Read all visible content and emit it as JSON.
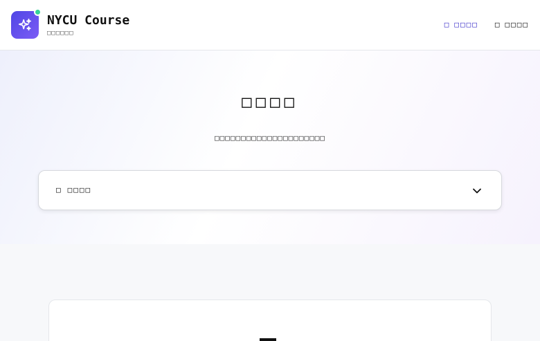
{
  "header": {
    "brand_title": "NYCU Course",
    "brand_subtitle": "□□□□□□",
    "nav": [
      {
        "icon_glyph": "□",
        "label": "□□□□",
        "active": true
      },
      {
        "icon_glyph": "□",
        "label": "□□□□",
        "active": false
      }
    ],
    "logo_icon": "sparkles-icon",
    "status_color": "#34d399"
  },
  "hero": {
    "title": "□□□□",
    "subtitle": "□□□□□□□□□□□□□□□□□□□□□",
    "select": {
      "icon_glyph": "□",
      "value": "□□□□",
      "chevron_icon": "chevron-down-icon"
    }
  },
  "colors": {
    "accent": "#4f46e5",
    "nav_active": "#3b2fc9"
  }
}
